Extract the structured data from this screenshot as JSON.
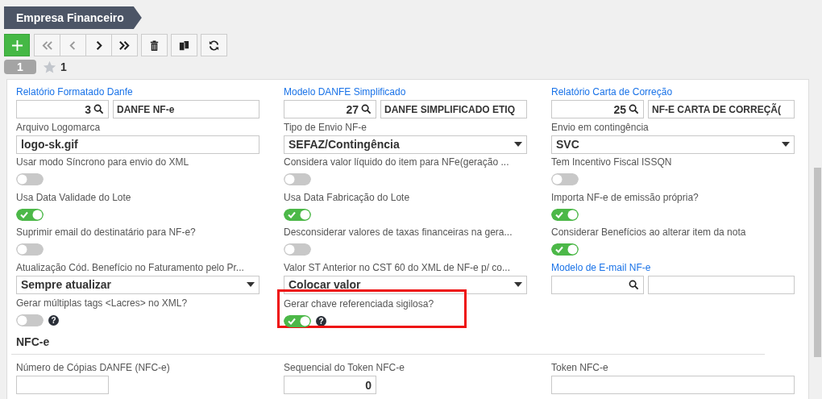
{
  "breadcrumb": {
    "title": "Empresa Financeiro"
  },
  "toolbar": [
    {
      "kind": "add",
      "disabled": false
    },
    {
      "kind": "first",
      "disabled": true
    },
    {
      "kind": "prev",
      "disabled": true
    },
    {
      "kind": "next",
      "disabled": false
    },
    {
      "kind": "last",
      "disabled": false
    },
    {
      "kind": "delete",
      "disabled": false
    },
    {
      "kind": "copy",
      "disabled": false
    },
    {
      "kind": "refresh",
      "disabled": false
    }
  ],
  "record": {
    "number": "1",
    "favorites": "1"
  },
  "fields": [
    {
      "kind": "lookup",
      "label": "Relatório Formatado Danfe",
      "code": "3",
      "description": "DANFE NF-e"
    },
    {
      "kind": "lookup",
      "label": "Modelo DANFE Simplificado",
      "code": "27",
      "description": "DANFE SIMPLIFICADO ETIQ"
    },
    {
      "kind": "lookup",
      "label": "Relatório Carta de Correção",
      "code": "25",
      "description": "NF-E CARTA DE CORREÇÃ("
    },
    {
      "kind": "text",
      "label": "Arquivo Logomarca",
      "value": "logo-sk.gif"
    },
    {
      "kind": "select",
      "label": "Tipo de Envio NF-e",
      "value": "SEFAZ/Contingência"
    },
    {
      "kind": "select",
      "label": "Envio em contingência",
      "value": "SVC"
    },
    {
      "kind": "toggle",
      "label": "Usar modo Síncrono para envio do XML",
      "on": false
    },
    {
      "kind": "toggle",
      "label": "Considera valor líquido do item para NFe(geração ...",
      "on": false
    },
    {
      "kind": "toggle",
      "label": "Tem Incentivo Fiscal ISSQN",
      "on": false
    },
    {
      "kind": "toggle",
      "label": "Usa Data Validade do Lote",
      "on": true
    },
    {
      "kind": "toggle",
      "label": "Usa Data Fabricação do Lote",
      "on": true
    },
    {
      "kind": "toggle",
      "label": "Importa NF-e de emissão própria?",
      "on": true
    },
    {
      "kind": "toggle",
      "label": "Suprimir email do destinatário para NF-e?",
      "on": false
    },
    {
      "kind": "toggle",
      "label": "Desconsiderar valores de taxas financeiras na gera...",
      "on": false
    },
    {
      "kind": "toggle",
      "label": "Considerar Benefícios ao alterar item da nota",
      "on": true
    },
    {
      "kind": "select",
      "label": "Atualização Cód. Benefício no Faturamento pelo Pr...",
      "value": "Sempre atualizar"
    },
    {
      "kind": "select",
      "label": "Valor ST Anterior no CST 60 do XML de NF-e p/ co...",
      "value": "Colocar valor"
    },
    {
      "kind": "lookup",
      "label": "Modelo de E-mail NF-e"
    },
    {
      "kind": "toggle",
      "label": "Gerar múltiplas tags <Lacres> no XML?",
      "on": false,
      "help": "?"
    },
    {
      "kind": "toggle",
      "label": "Gerar chave referenciada sigilosa?",
      "on": true,
      "help": "?",
      "highlighted": true
    }
  ],
  "section": {
    "title": "NFC-e",
    "fields": [
      {
        "kind": "short",
        "label": "Número de Cópias DANFE (NFC-e)"
      },
      {
        "kind": "short",
        "label": "Sequencial do Token NFC-e",
        "value": "0"
      },
      {
        "kind": "wide",
        "label": "Token NFC-e"
      }
    ]
  }
}
